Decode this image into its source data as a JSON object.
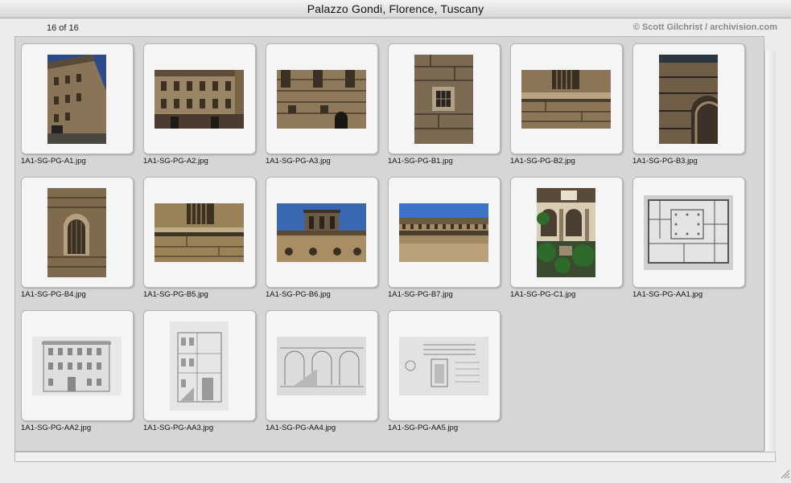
{
  "window": {
    "title": "Palazzo Gondi, Florence, Tuscany"
  },
  "header": {
    "count": "16 of 16",
    "credit": "© Scott Gilchrist / archivision.com"
  },
  "thumbnails": [
    {
      "filename": "1A1-SG-PG-A1.jpg",
      "icon": "facade-street-photo-icon"
    },
    {
      "filename": "1A1-SG-PG-A2.jpg",
      "icon": "facade-wide-photo-icon"
    },
    {
      "filename": "1A1-SG-PG-A3.jpg",
      "icon": "rusticated-wall-photo-icon"
    },
    {
      "filename": "1A1-SG-PG-B1.jpg",
      "icon": "window-detail-photo-icon"
    },
    {
      "filename": "1A1-SG-PG-B2.jpg",
      "icon": "stone-course-photo-icon"
    },
    {
      "filename": "1A1-SG-PG-B3.jpg",
      "icon": "arched-stone-photo-icon"
    },
    {
      "filename": "1A1-SG-PG-B4.jpg",
      "icon": "arched-window-photo-icon"
    },
    {
      "filename": "1A1-SG-PG-B5.jpg",
      "icon": "shuttered-window-photo-icon"
    },
    {
      "filename": "1A1-SG-PG-B6.jpg",
      "icon": "tower-sky-photo-icon"
    },
    {
      "filename": "1A1-SG-PG-B7.jpg",
      "icon": "cornice-sky-photo-icon"
    },
    {
      "filename": "1A1-SG-PG-C1.jpg",
      "icon": "courtyard-photo-icon"
    },
    {
      "filename": "1A1-SG-PG-AA1.jpg",
      "icon": "floor-plan-drawing-icon"
    },
    {
      "filename": "1A1-SG-PG-AA2.jpg",
      "icon": "elevation-drawing-icon"
    },
    {
      "filename": "1A1-SG-PG-AA3.jpg",
      "icon": "section-drawing-icon"
    },
    {
      "filename": "1A1-SG-PG-AA4.jpg",
      "icon": "courtyard-drawing-icon"
    },
    {
      "filename": "1A1-SG-PG-AA5.jpg",
      "icon": "cornice-drawing-icon"
    }
  ]
}
